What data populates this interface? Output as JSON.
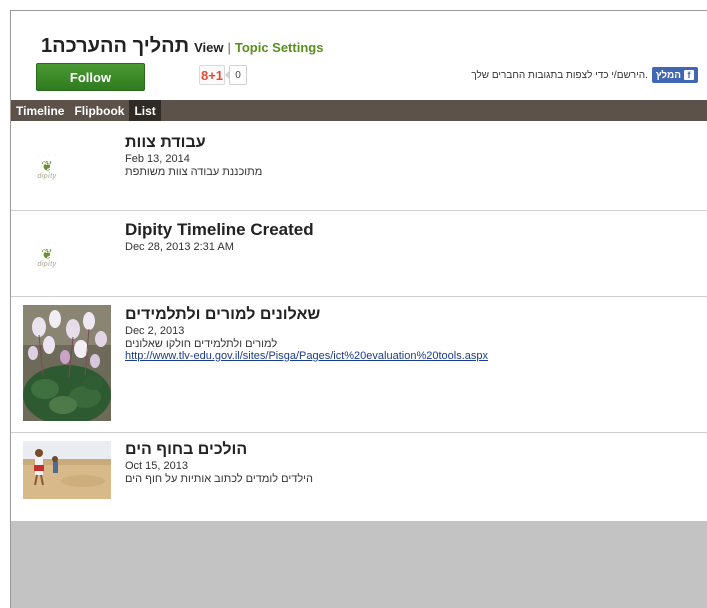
{
  "header": {
    "title": "תהליך ההערכה1",
    "view_label": "View",
    "separator": "|",
    "settings_label": "Topic Settings"
  },
  "actions": {
    "follow_label": "Follow",
    "gplus_label": "8+1",
    "gplus_count": "0",
    "fb_button_label": "המלץ",
    "fb_text": "הירשם/י כדי לצפות בתגובות החברים שלך."
  },
  "tabs": [
    {
      "label": "Timeline",
      "active": false
    },
    {
      "label": "Flipbook",
      "active": false
    },
    {
      "label": "List",
      "active": true
    }
  ],
  "items": [
    {
      "title": "עבודת צוות",
      "date": "Feb 13, 2014",
      "desc": "מתוכננת עבודה צוות משותפת",
      "thumb": "dipity-logo",
      "logo_word": "dipity"
    },
    {
      "title": "Dipity Timeline Created",
      "date": "Dec 28, 2013 2:31 AM",
      "desc": "",
      "thumb": "dipity-logo",
      "logo_word": "dipity"
    },
    {
      "title": "שאלונים למורים ולתלמידים",
      "date": "Dec 2, 2013",
      "desc": "למורים ולתלמידים חולקו שאלונים",
      "link": "http://www.tlv-edu.gov.il/sites/Pisga/Pages/ict%20evaluation%20tools.aspx",
      "thumb": "cyclamen-photo"
    },
    {
      "title": "הולכים בחוף הים",
      "date": "Oct 15, 2013",
      "desc": "הילדים לומדים לכתוב אותיות על חוף הים",
      "thumb": "beach-photo"
    }
  ],
  "colors": {
    "tab_bar": "#5c524a",
    "follow_green": "#3a8a28",
    "settings_green": "#5a8f1d",
    "facebook_blue": "#4267b2"
  }
}
